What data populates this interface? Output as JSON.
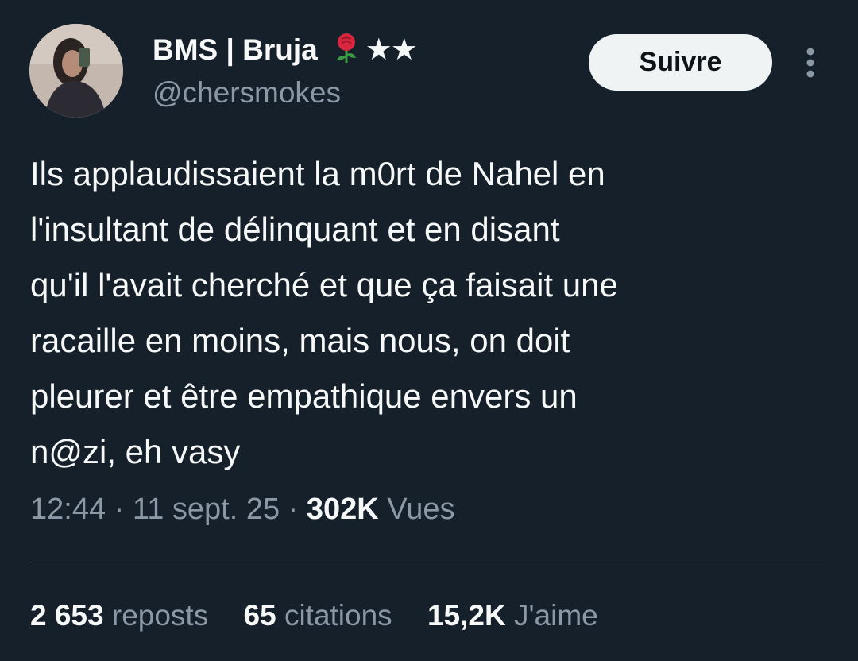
{
  "user": {
    "display_name": "BMS | Bruja",
    "badges": "★★",
    "emoji_icon": "rose-icon",
    "handle": "@chersmokes",
    "avatar_icon": "avatar-photo"
  },
  "follow_button": {
    "label": "Suivre"
  },
  "more_icon": "more-vertical-icon",
  "tweet": {
    "text": "Ils applaudissaient la m0rt de Nahel en\nl'insultant de délinquant et en disant\nqu'il l'avait cherché et que ça faisait une\nracaille en moins, mais nous, on doit\npleurer et être empathique envers un\nn@zi, eh vasy"
  },
  "meta": {
    "time": "12:44",
    "separator": "·",
    "date": "11 sept. 25",
    "views_count": "302K",
    "views_label": "Vues"
  },
  "stats": {
    "reposts_count": "2 653",
    "reposts_label": "reposts",
    "quotes_count": "65",
    "quotes_label": "citations",
    "likes_count": "15,2K",
    "likes_label": "J'aime"
  },
  "colors": {
    "background": "#15202b",
    "text_primary": "#f7f9f9",
    "text_secondary": "#8b98a5",
    "button_bg": "#eff3f4",
    "divider": "#38444d"
  }
}
